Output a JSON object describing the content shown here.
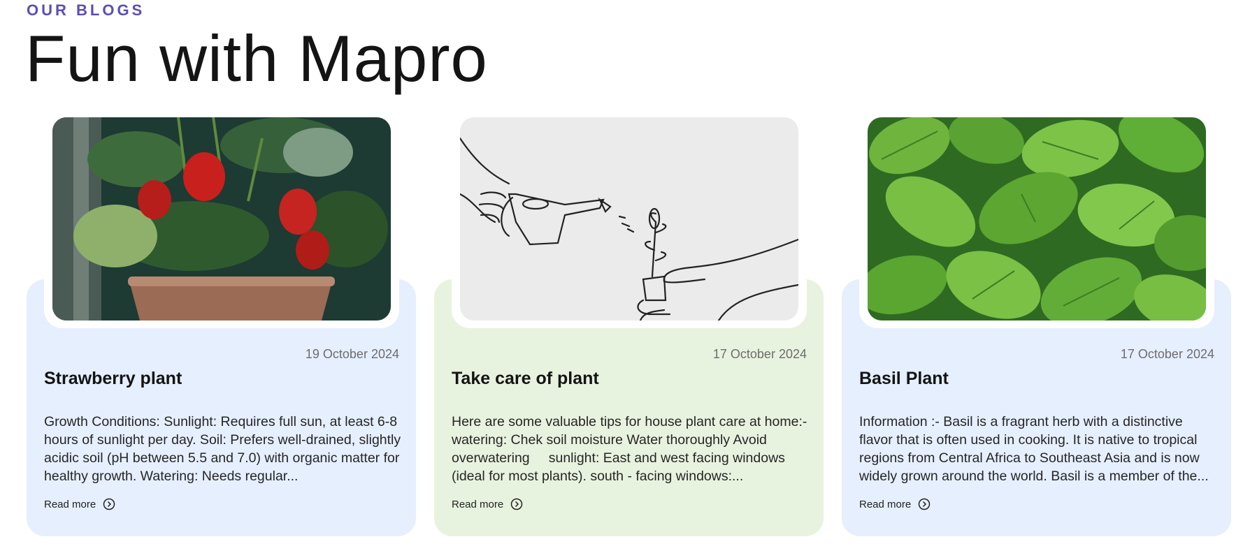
{
  "section": {
    "eyebrow": "OUR BLOGS",
    "title": "Fun with Mapro"
  },
  "colors": {
    "accent": "#5b4fb3",
    "card_blue": "#e6effd",
    "card_green": "#e8f3df"
  },
  "posts": [
    {
      "date": "19 October 2024",
      "title": "Strawberry plant",
      "excerpt": "Growth Conditions: Sunlight: Requires full sun, at least 6-8 hours of sunlight per day. Soil: Prefers well-drained, slightly acidic soil (pH between 5.5 and 7.0) with organic matter for healthy growth. Watering: Needs regular...",
      "read_more": "Read more",
      "image": "strawberry-plant-photo"
    },
    {
      "date": "17 October 2024",
      "title": "Take care of plant",
      "excerpt": "Here are some valuable tips for house plant care at home:-   watering: Chek soil moisture Water thoroughly Avoid overwatering     sunlight: East and west facing windows (ideal for most plants). south - facing windows:...",
      "read_more": "Read more",
      "image": "watering-can-line-drawing"
    },
    {
      "date": "17 October 2024",
      "title": "Basil Plant",
      "excerpt": "Information :- Basil is a fragrant herb with a distinctive flavor that is often used in cooking. It is native to tropical regions from Central Africa to Southeast Asia and is now widely grown around the world. Basil is a member of the...",
      "read_more": "Read more",
      "image": "basil-leaves-photo"
    }
  ]
}
